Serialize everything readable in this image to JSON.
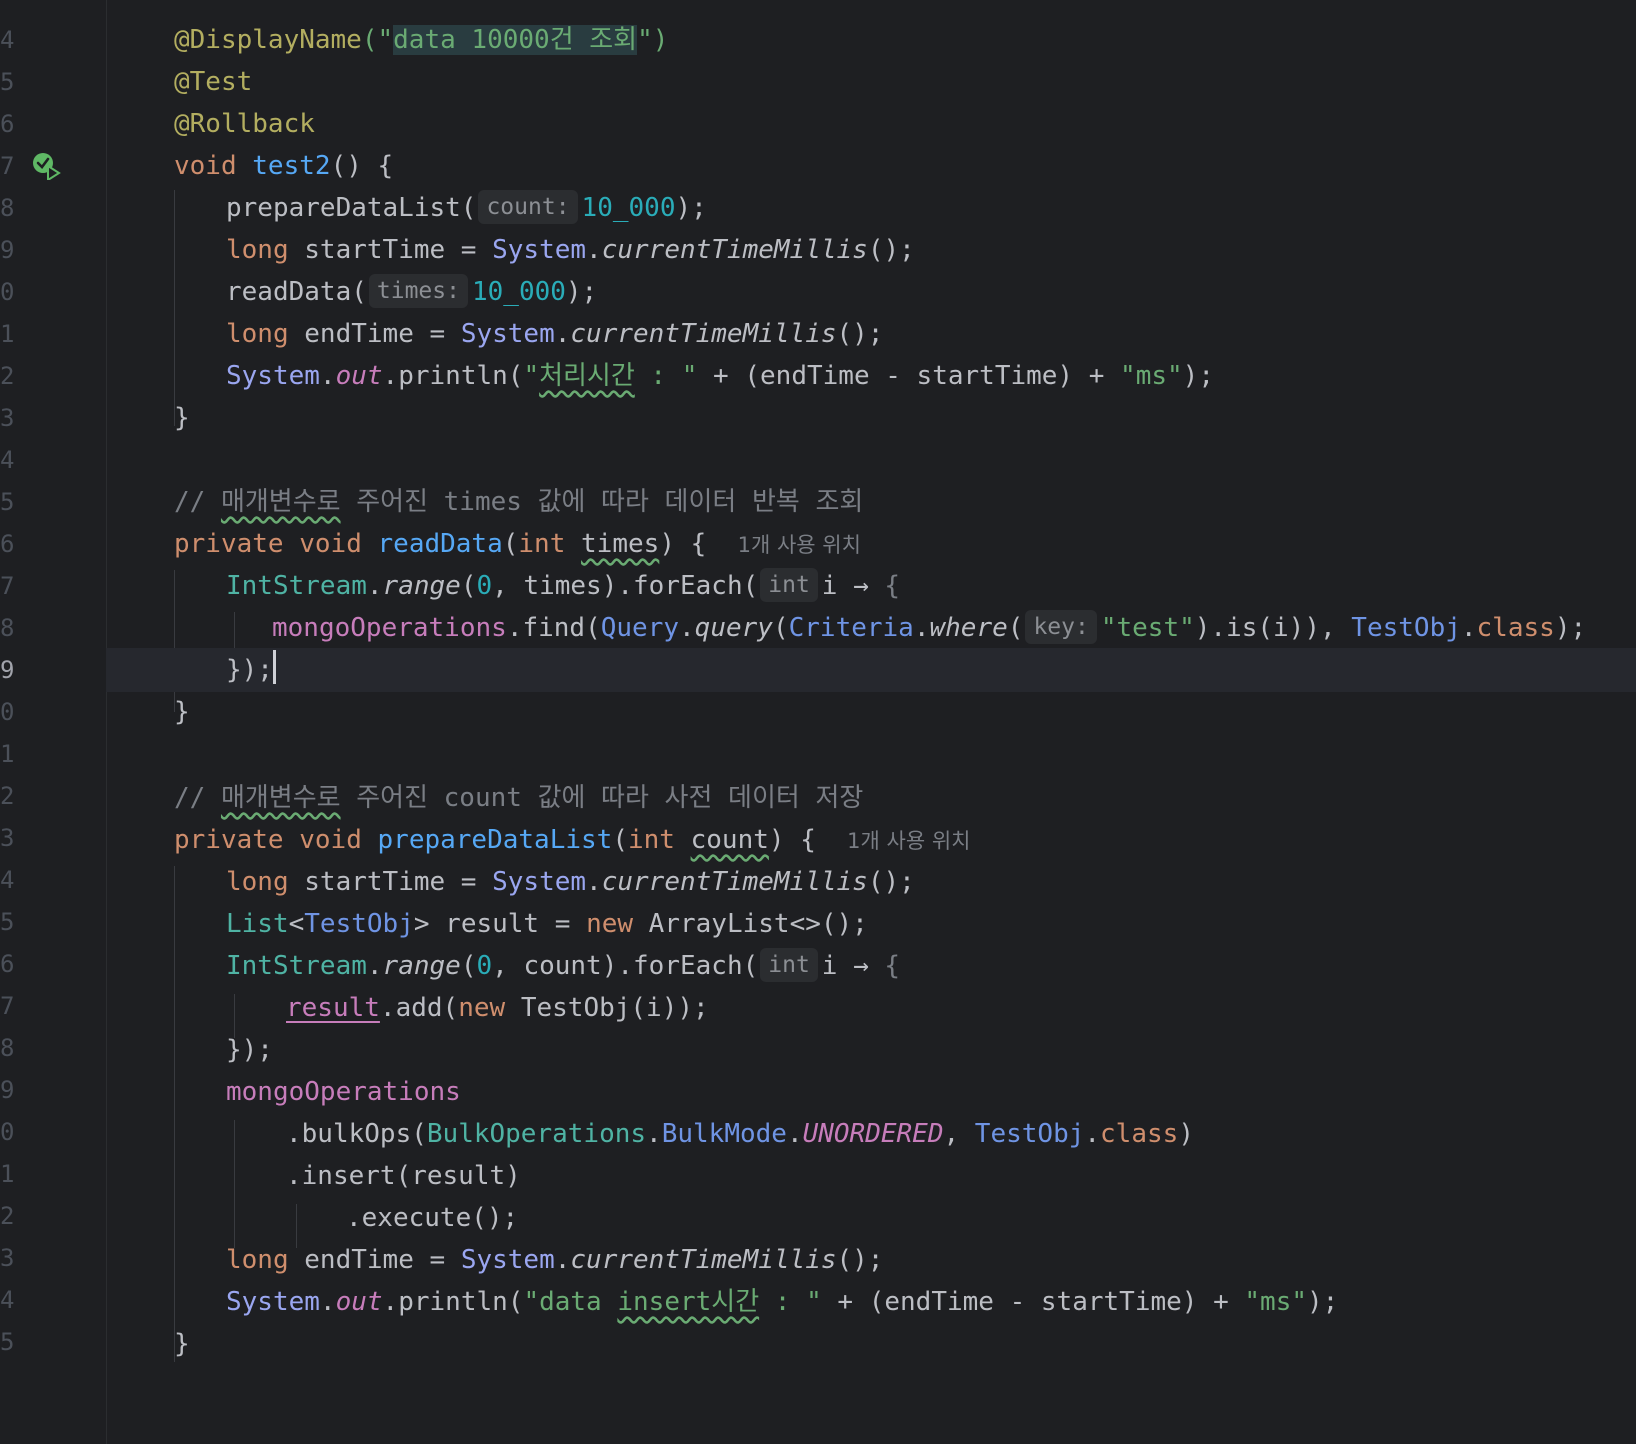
{
  "gutter": {
    "line_numbers": [
      "4",
      "5",
      "6",
      "7",
      "8",
      "9",
      "0",
      "1",
      "2",
      "3",
      "4",
      "5",
      "6",
      "7",
      "8",
      "9",
      "0",
      "1",
      "2",
      "3",
      "4",
      "5",
      "6",
      "7",
      "8",
      "9",
      "0",
      "1",
      "2",
      "3",
      "4",
      "5"
    ],
    "current_index": 15
  },
  "code": {
    "l1": {
      "annotation": "@DisplayName",
      "open": "(\"",
      "value": "data 10000건 조회",
      "close": "\")"
    },
    "l2": {
      "annotation": "@Test"
    },
    "l3": {
      "annotation": "@Rollback"
    },
    "l4": {
      "kw": "void",
      "name": "test2",
      "rest": "() {"
    },
    "l5": {
      "call": "prepareDataList(",
      "hint": "count:",
      "num": "10_000",
      "end": ");"
    },
    "l6": {
      "kw": "long",
      "mid": " startTime = ",
      "cls": "System",
      "dot": ".",
      "method": "currentTimeMillis",
      "end": "();"
    },
    "l7": {
      "call": "readData(",
      "hint": "times:",
      "num": "10_000",
      "end": ");"
    },
    "l8": {
      "kw": "long",
      "mid": " endTime = ",
      "cls": "System",
      "dot": ".",
      "method": "currentTimeMillis",
      "end": "();"
    },
    "l9": {
      "cls": "System",
      "dot": ".",
      "field": "out",
      "call": ".println(",
      "s1a": "\"",
      "s1w": "처리시간",
      "s1b": " : \"",
      "mid": " + (endTime - startTime) + ",
      "s2": "\"ms\"",
      "end": ");"
    },
    "l10": {
      "text": "}"
    },
    "l12": {
      "slash": "// ",
      "w": "매개변수로",
      "rest": " 주어진 times 값에 따라 데이터 반복 조회"
    },
    "l13": {
      "kw1": "private",
      "kw2": "void",
      "name": "readData",
      "open": "(",
      "kw3": "int",
      "param": "times",
      "close": ") {",
      "usage": "1개 사용 위치"
    },
    "l14": {
      "cls": "IntStream",
      "dot": ".",
      "method": "range",
      "open": "(",
      "num": "0",
      "mid": ", times).forEach(",
      "hint": "int",
      "lam": "i → ",
      "brace": "{"
    },
    "l15": {
      "field": "mongoOperations",
      "find": ".find(",
      "q": "Query",
      "dot1": ".",
      "qm": "query",
      "p1": "(",
      "cr": "Criteria",
      "dot2": ".",
      "wh": "where",
      "p2": "(",
      "hint": "key:",
      "str": "\"test\"",
      "is": ").is(i)), ",
      "tc": "TestObj",
      "dot3": ".",
      "kwc": "class",
      "end": ");"
    },
    "l16": {
      "text": "});"
    },
    "l17": {
      "text": "}"
    },
    "l19": {
      "slash": "// ",
      "w": "매개변수로",
      "rest": " 주어진 count 값에 따라 사전 데이터 저장"
    },
    "l20": {
      "kw1": "private",
      "kw2": "void",
      "name": "prepareDataList",
      "open": "(",
      "kw3": "int",
      "param": "count",
      "close": ") {",
      "usage": "1개 사용 위치"
    },
    "l21": {
      "kw": "long",
      "mid": " startTime = ",
      "cls": "System",
      "dot": ".",
      "method": "currentTimeMillis",
      "end": "();"
    },
    "l22": {
      "list": "List",
      "lt": "<",
      "tc": "TestObj",
      "gt": ">",
      "mid": " result = ",
      "kw": "new",
      "rest": " ArrayList<>();"
    },
    "l23": {
      "cls": "IntStream",
      "dot": ".",
      "method": "range",
      "open": "(",
      "num": "0",
      "mid": ", count).forEach(",
      "hint": "int",
      "lam": "i → ",
      "brace": "{"
    },
    "l24": {
      "var": "result",
      "add": ".add(",
      "kw": "new",
      "rest": " TestObj(i));"
    },
    "l25": {
      "text": "});"
    },
    "l26": {
      "field": "mongoOperations"
    },
    "l27": {
      "bulk": ".bulkOps(",
      "bo": "BulkOperations",
      "dot1": ".",
      "bm": "BulkMode",
      "dot2": ".",
      "en": "UNORDERED",
      "comma": ", ",
      "tc": "TestObj",
      "dot3": ".",
      "kwc": "class",
      "end": ")"
    },
    "l28": {
      "text": ".insert(result)"
    },
    "l29": {
      "text": ".execute();"
    },
    "l30": {
      "kw": "long",
      "mid": " endTime = ",
      "cls": "System",
      "dot": ".",
      "method": "currentTimeMillis",
      "end": "();"
    },
    "l31": {
      "cls": "System",
      "dot": ".",
      "field": "out",
      "call": ".println(",
      "s1a": "\"data ",
      "s1w": "insert시간",
      "s1b": " : \"",
      "mid": " + (endTime - startTime) + ",
      "s2": "\"ms\"",
      "end": ");"
    },
    "l32": {
      "text": "}"
    }
  },
  "icons": {
    "run_test": "run-test-passed-icon",
    "intention": "lightbulb-icon"
  },
  "colors": {
    "background": "#1e1f22",
    "keyword": "#cf8e6d",
    "annotation": "#b3ae60",
    "function": "#56a8f5",
    "string": "#6aab73",
    "number": "#2aacb8",
    "field": "#c77dbb",
    "comment": "#7a7e85"
  }
}
